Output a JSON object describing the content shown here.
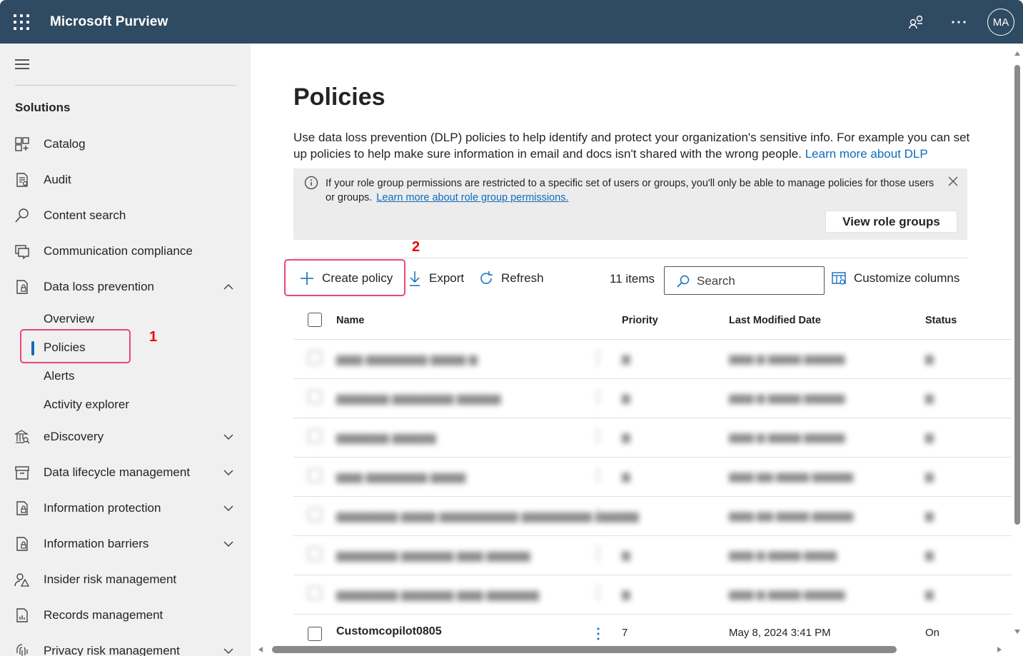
{
  "app": {
    "title": "Microsoft Purview",
    "avatar_initials": "MA"
  },
  "sidebar": {
    "section_title": "Solutions",
    "items": [
      {
        "label": "Catalog",
        "icon": "catalog-icon"
      },
      {
        "label": "Audit",
        "icon": "audit-icon"
      },
      {
        "label": "Content search",
        "icon": "search-icon"
      },
      {
        "label": "Communication compliance",
        "icon": "chat-icon"
      },
      {
        "label": "Data loss prevention",
        "icon": "dlp-icon",
        "expanded": true
      },
      {
        "label": "eDiscovery",
        "icon": "ediscovery-icon"
      },
      {
        "label": "Data lifecycle management",
        "icon": "archive-icon"
      },
      {
        "label": "Information protection",
        "icon": "info-protection-icon"
      },
      {
        "label": "Information barriers",
        "icon": "info-barriers-icon"
      },
      {
        "label": "Insider risk management",
        "icon": "insider-risk-icon"
      },
      {
        "label": "Records management",
        "icon": "records-icon"
      },
      {
        "label": "Privacy risk management",
        "icon": "privacy-icon"
      }
    ],
    "dlp_subitems": [
      "Overview",
      "Policies",
      "Alerts",
      "Activity explorer"
    ],
    "selected_subitem": "Policies"
  },
  "annotations": {
    "one": "1",
    "two": "2",
    "color": "#e8477a"
  },
  "main": {
    "title": "Policies",
    "description": "Use data loss prevention (DLP) policies to help identify and protect your organization's sensitive info. For example you can set up policies to help make sure information in email and docs isn't shared with the wrong people.",
    "description_link": "Learn more about DLP",
    "info_text": "If your role group permissions are restricted to a specific set of users or groups, you'll only be able to manage policies for those users or groups.",
    "info_link": "Learn more about role group permissions.",
    "view_roles_label": "View role groups",
    "toolbar": {
      "create_label": "Create policy",
      "export_label": "Export",
      "refresh_label": "Refresh",
      "items_count": "11 items",
      "search_placeholder": "Search",
      "customize_label": "Customize columns"
    },
    "table": {
      "columns": [
        "Name",
        "Priority",
        "Last Modified Date",
        "Status"
      ],
      "visible_row": {
        "name": "Customcopilot0805",
        "priority": "7",
        "modified": "May 8, 2024 3:41 PM",
        "status": "On"
      }
    }
  },
  "colors": {
    "header_bg": "#2f4a63",
    "accent": "#0f6cbd",
    "sidebar_bg": "#f0f0f0"
  }
}
